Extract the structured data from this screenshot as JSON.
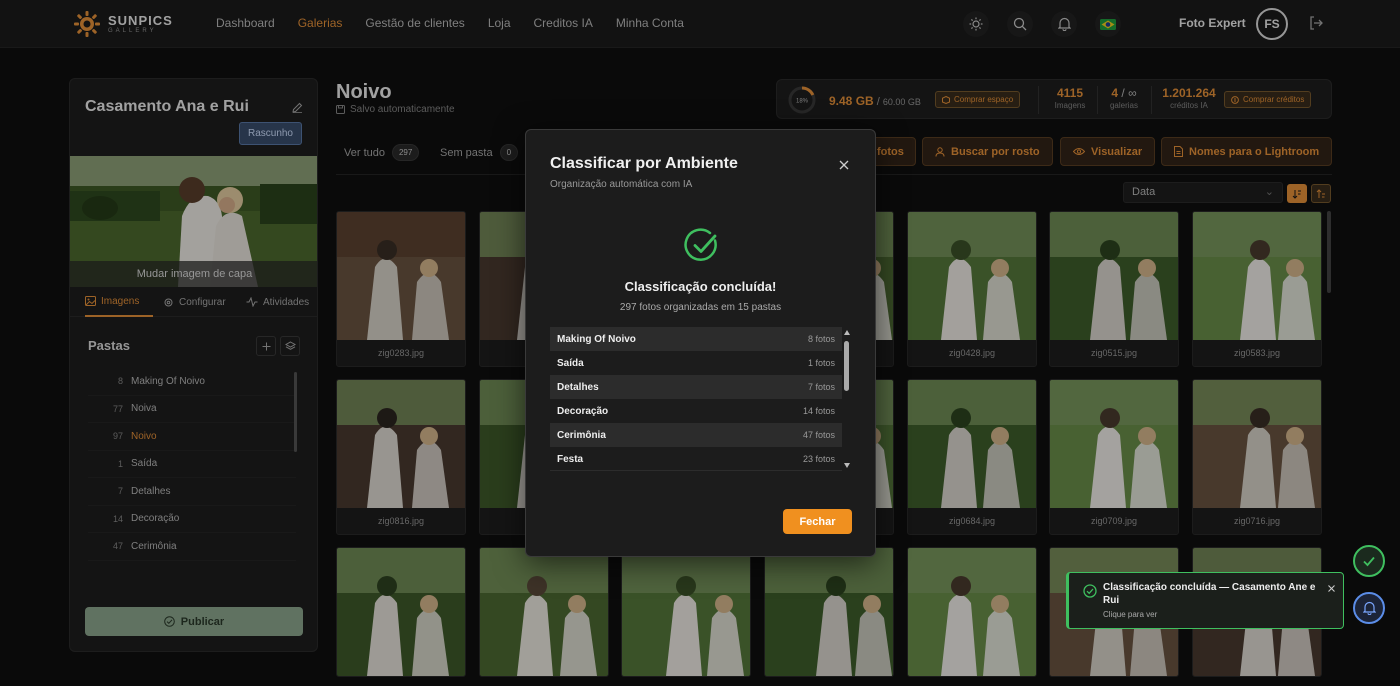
{
  "brand": {
    "name": "SUNPICS",
    "tagline": "GALLERY",
    "accent": "#e8923a"
  },
  "nav": {
    "items": [
      "Dashboard",
      "Galerias",
      "Gestão de clientes",
      "Loja",
      "Creditos IA",
      "Minha Conta"
    ],
    "active": "Galerias"
  },
  "user": {
    "name": "Foto Expert",
    "initials": "FS"
  },
  "album": {
    "title": "Casamento Ana e Rui",
    "status": "Rascunho",
    "cover_label": "Mudar imagem de capa",
    "tabs": [
      "Imagens",
      "Configurar",
      "Atividades"
    ],
    "folders_title": "Pastas",
    "folders": [
      {
        "count": "8",
        "name": "Making Of Noivo"
      },
      {
        "count": "77",
        "name": "Noiva"
      },
      {
        "count": "97",
        "name": "Noivo"
      },
      {
        "count": "1",
        "name": "Saída"
      },
      {
        "count": "7",
        "name": "Detalhes"
      },
      {
        "count": "14",
        "name": "Decoração"
      },
      {
        "count": "47",
        "name": "Cerimônia"
      }
    ],
    "publish_label": "Publicar"
  },
  "header": {
    "title": "Noivo",
    "autosave": "Salvo automaticamente"
  },
  "stats": {
    "storage_pct": "18%",
    "storage_used": "9.48 GB",
    "storage_total": "60.00 GB",
    "buy_space": "Comprar espaço",
    "images_value": "4115",
    "images_label": "Imagens",
    "galleries_value": "4",
    "galleries_total": "∞",
    "galleries_label": "galerias",
    "credits_value": "1.201.264",
    "credits_label": "créditos IA",
    "buy_credits": "Comprar créditos"
  },
  "filters": {
    "all_label": "Ver tudo",
    "all_count": "297",
    "nofolder_label": "Sem pasta",
    "nofolder_count": "0"
  },
  "actions": {
    "fotos_partial": "fotos",
    "face_search": "Buscar por rosto",
    "view": "Visualizar",
    "lightroom": "Nomes para o Lightroom"
  },
  "sort": {
    "selected": "Data"
  },
  "photos": {
    "row1": [
      "zig0283.jpg",
      "zig0",
      "",
      "",
      "zig0428.jpg",
      "zig0515.jpg",
      "zig0583.jpg"
    ],
    "row2": [
      "zig0816.jpg",
      "zi",
      "",
      "",
      "zig0684.jpg",
      "zig0709.jpg",
      "zig0716.jpg"
    ]
  },
  "modal": {
    "title": "Classificar por Ambiente",
    "subtitle": "Organização automática com IA",
    "done_title": "Classificação concluída!",
    "done_sub": "297 fotos organizadas em 15 pastas",
    "results": [
      {
        "name": "Making Of Noivo",
        "count": "8 fotos"
      },
      {
        "name": "Saída",
        "count": "1 fotos"
      },
      {
        "name": "Detalhes",
        "count": "7 fotos"
      },
      {
        "name": "Decoração",
        "count": "14 fotos"
      },
      {
        "name": "Cerimônia",
        "count": "47 fotos"
      },
      {
        "name": "Festa",
        "count": "23 fotos"
      }
    ],
    "close_label": "Fechar"
  },
  "toast": {
    "title": "Classificação concluída — Casamento Ane e Rui",
    "subtitle": "Clique para ver"
  }
}
